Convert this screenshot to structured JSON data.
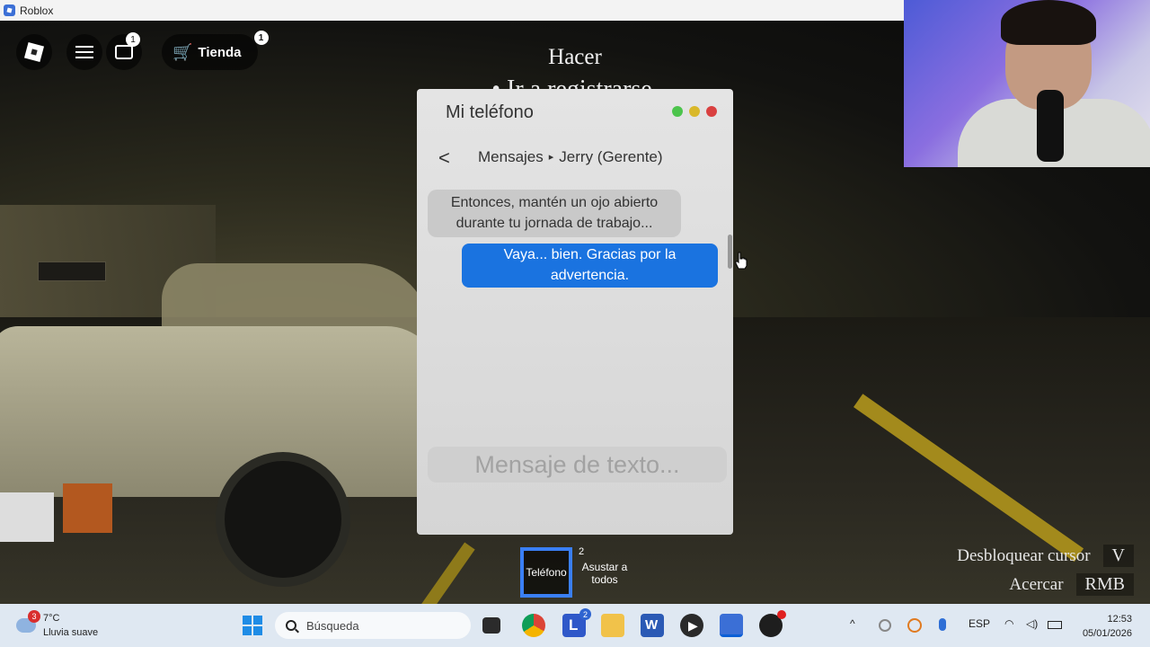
{
  "window": {
    "title": "Roblox"
  },
  "roblox": {
    "chat_badge": "1",
    "store_label": "Tienda",
    "store_badge": "1"
  },
  "task": {
    "title": "Hacer",
    "item": "• Ir a registrarse."
  },
  "phone": {
    "title": "Mi teléfono",
    "back": "<",
    "breadcrumb_root": "Mensajes",
    "breadcrumb_sep": "▸",
    "breadcrumb_contact": "Jerry (Gerente)",
    "messages": [
      {
        "from": "contact",
        "text": "Entonces, mantén un ojo abierto durante tu jornada de trabajo..."
      },
      {
        "from": "me",
        "text": "Vaya... bien. Gracias por la advertencia."
      }
    ],
    "input_placeholder": "Mensaje de texto...",
    "dot_colors": [
      "#4cc44c",
      "#d9b82a",
      "#d94040"
    ]
  },
  "hotbar": {
    "slot1_label": "Teléfono",
    "slot2_number": "2",
    "slot2_label": "Asustar a todos"
  },
  "hints": [
    {
      "label": "Desbloquear cursor",
      "key": "V"
    },
    {
      "label": "Acercar",
      "key": "RMB"
    }
  ],
  "taskbar": {
    "weather_badge": "3",
    "temperature": "7°C",
    "weather": "Lluvia suave",
    "search_placeholder": "Búsqueda",
    "l_badge": "2",
    "language": "ESP",
    "time": "12:53",
    "date": "05/01/2026"
  }
}
